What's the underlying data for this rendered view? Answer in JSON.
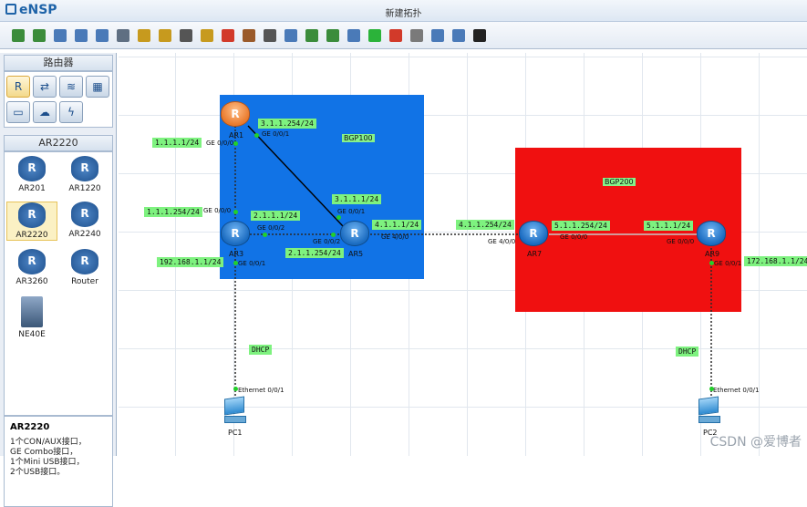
{
  "app": {
    "logo": "eNSP",
    "title": "新建拓扑"
  },
  "toolbar": {
    "icons": [
      "new-topology-icon",
      "new-lab-icon",
      "open-icon",
      "save-icon",
      "save-as-icon",
      "print-icon",
      "undo-icon",
      "redo-icon",
      "select-icon",
      "drag-icon",
      "delete-icon",
      "delete-link-icon",
      "text-icon",
      "palette-icon",
      "zoom-in-icon",
      "zoom-out-icon",
      "fit-icon",
      "start-icon",
      "stop-icon",
      "capture-icon",
      "layout-icon",
      "topo-icon",
      "console-icon"
    ]
  },
  "palette": {
    "category_header": "路由器",
    "device_header": "AR2220",
    "devices": [
      {
        "label": "AR201"
      },
      {
        "label": "AR1220"
      },
      {
        "label": "AR2220"
      },
      {
        "label": "AR2240"
      },
      {
        "label": "AR3260"
      },
      {
        "label": "Router"
      },
      {
        "label": "NE40E"
      }
    ],
    "info_title": "AR2220",
    "info_lines": [
      "1个CON/AUX接口，",
      "GE Combo接口，",
      "1个Mini USB接口，",
      "2个USB接口。"
    ]
  },
  "topology": {
    "areas": [
      {
        "label": "BGP100",
        "color": "#1173e6"
      },
      {
        "label": "BGP200",
        "color": "#f01010"
      }
    ],
    "devices": {
      "ar1": "AR1",
      "ar3": "AR3",
      "ar5": "AR5",
      "ar7": "AR7",
      "ar9": "AR9",
      "pc1": "PC1",
      "pc2": "PC2"
    },
    "ip_labels": {
      "ar1_left": "1.1.1.1/24",
      "ar1_right": "3.1.1.254/24",
      "ar3_top": "1.1.1.254/24",
      "ar3_right": "2.1.1.1/24",
      "ar3_bottom": "192.168.1.1/24",
      "ar5_top": "3.1.1.1/24",
      "ar5_bottom": "2.1.1.254/24",
      "ar5_right": "4.1.1.1/24",
      "ar7_left": "4.1.1.254/24",
      "ar7_right": "5.1.1.254/24",
      "ar9_left": "5.1.1.1/24",
      "ar9_right": "172.168.1.1/24",
      "dhcp_left": "DHCP",
      "dhcp_right": "DHCP"
    },
    "ports": {
      "ar1_g000": "GE 0/0/0",
      "ar1_g001": "GE 0/0/1",
      "ar3_g000": "GE 0/0/0",
      "ar3_g002": "GE 0/0/2",
      "ar3_g001": "GE 0/0/1",
      "ar5_g001": "GE 0/0/1",
      "ar5_g002": "GE 0/0/2",
      "ar5_g400": "GE 4/0/0",
      "ar7_g400": "GE 4/0/0",
      "ar7_g000": "GE 0/0/0",
      "ar9_g000": "GE 0/0/0",
      "ar9_g001": "GE 0/0/1",
      "pc1_eth": "Ethernet 0/0/1",
      "pc2_eth": "Ethernet 0/0/1"
    }
  },
  "watermark": "CSDN @爱博者"
}
